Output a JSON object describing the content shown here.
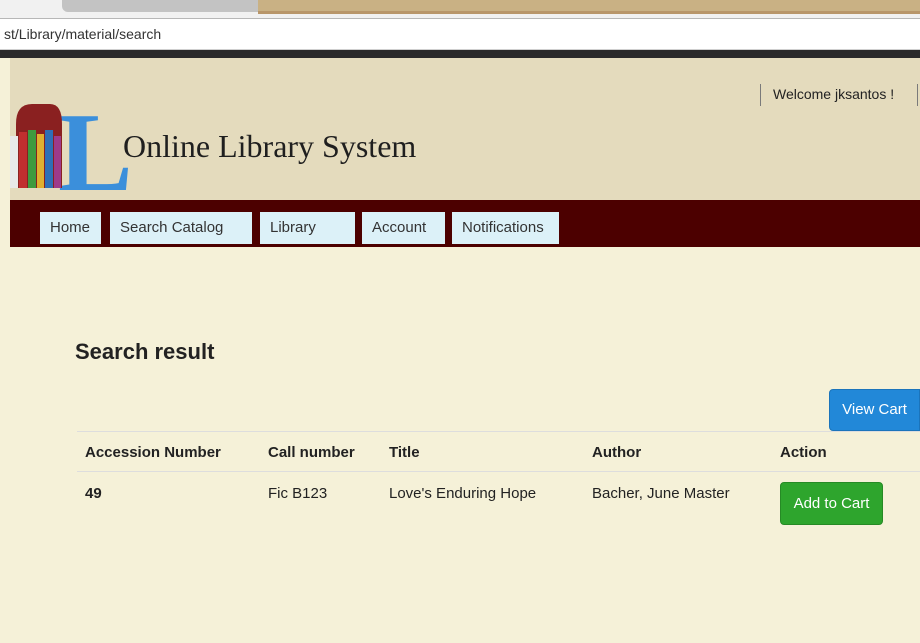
{
  "browser": {
    "url": "st/Library/material/search"
  },
  "header": {
    "welcome": "Welcome jksantos !",
    "site_title": "Online Library System",
    "logo_letter": "L"
  },
  "nav": {
    "items": [
      {
        "label": "Home"
      },
      {
        "label": "Search Catalog"
      },
      {
        "label": "Library"
      },
      {
        "label": "Account"
      },
      {
        "label": "Notifications"
      }
    ]
  },
  "results": {
    "title": "Search result",
    "view_cart_label": "View Cart",
    "columns": [
      "Accession Number",
      "Call number",
      "Title",
      "Author",
      "Action"
    ],
    "rows": [
      {
        "accession_number": "49",
        "call_number": "Fic B123",
        "title": "Love's Enduring Hope",
        "author": "Bacher, June Master",
        "action_label": "Add to Cart"
      }
    ]
  },
  "colors": {
    "header_bg": "#e4dbbd",
    "nav_bg": "#4c0000",
    "page_bg": "#f5f1d8",
    "primary_button": "#2288d8",
    "success_button": "#2ea52d",
    "logo_blue": "#3b8fdb"
  },
  "icons": [
    "library-logo-books-icon"
  ]
}
